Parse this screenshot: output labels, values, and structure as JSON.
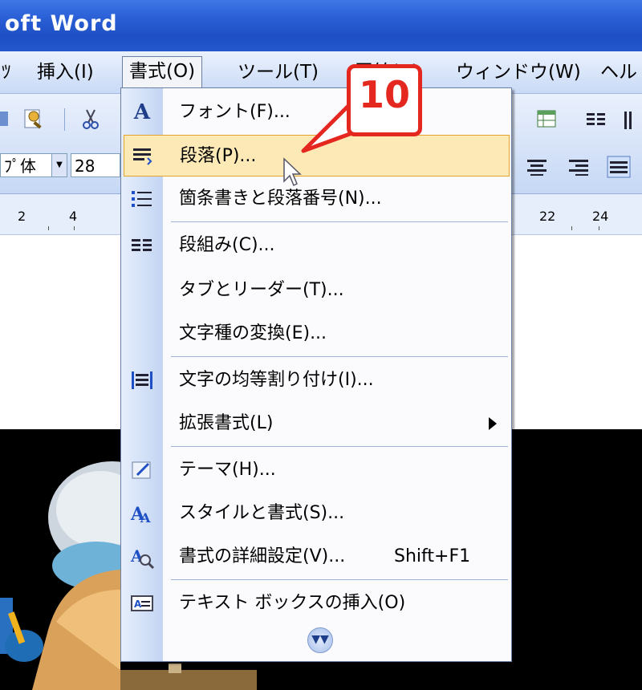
{
  "window": {
    "title": "oft Word"
  },
  "menubar": {
    "items": [
      "ﾂ",
      "挿入(I)",
      "書式(O)",
      "ツール(T)",
      "罫線(A)",
      "ウィンドウ(W)",
      "ヘル"
    ]
  },
  "toolbar": {
    "font_combo": "ﾌﾟ体",
    "size_combo": "28"
  },
  "ruler": {
    "numbers_left": [
      "2",
      "4"
    ],
    "numbers_right": [
      "22",
      "24"
    ]
  },
  "format_menu": {
    "items": [
      {
        "label": "フォント(F)...",
        "icon": "font-a-icon"
      },
      {
        "label": "段落(P)...",
        "icon": "paragraph-icon"
      },
      {
        "label": "箇条書きと段落番号(N)...",
        "icon": "bullets-icon"
      },
      {
        "label": "段組み(C)...",
        "icon": "columns-icon"
      },
      {
        "label": "タブとリーダー(T)...",
        "icon": ""
      },
      {
        "label": "文字種の変換(E)...",
        "icon": ""
      },
      {
        "label": "文字の均等割り付け(I)...",
        "icon": "distribute-icon"
      },
      {
        "label": "拡張書式(L)",
        "icon": ""
      },
      {
        "label": "テーマ(H)...",
        "icon": "theme-icon"
      },
      {
        "label": "スタイルと書式(S)...",
        "icon": "styles-icon"
      },
      {
        "label": "書式の詳細設定(V)...",
        "icon": "reveal-format-icon",
        "shortcut": "Shift+F1"
      },
      {
        "label": "テキスト ボックスの挿入(O)",
        "icon": "textbox-icon"
      }
    ],
    "highlighted_index": 1
  },
  "callout": {
    "number": "10"
  },
  "colors": {
    "title_bar": "#2a5fd6",
    "callout_red": "#e4271f",
    "highlight": "#fde9b6"
  }
}
